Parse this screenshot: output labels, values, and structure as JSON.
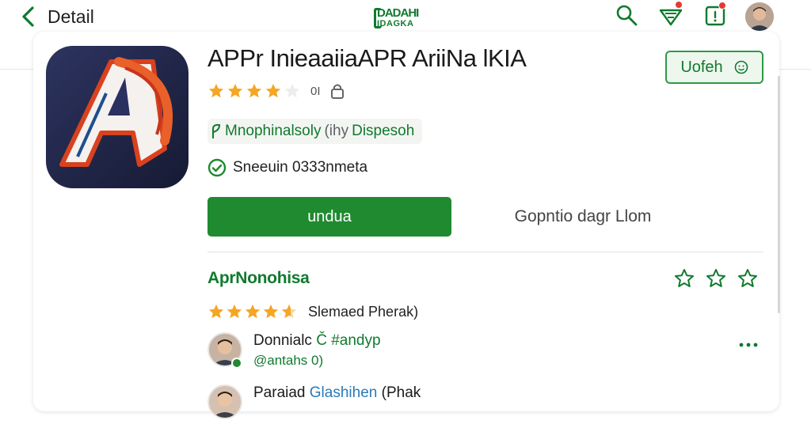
{
  "header": {
    "back_label": "Detail",
    "logo_line1": "DADAHI",
    "logo_line2": "IDAGKA"
  },
  "app": {
    "title": "APPr InieaaiiaAPR AriiNa lKIA",
    "rating_text": "0I",
    "rating_stars": 4,
    "tag_green": "Mnophinalsoly",
    "tag_gray": "(ihy",
    "tag_green2": "Dispesoh",
    "verified_text": "Sneeuin 0333nmeta",
    "install_label": "undua",
    "secondary_label": "Gopntio dagr Llom",
    "follow_label": "Uofeh"
  },
  "reviews_section": {
    "title": "AprNonohisa",
    "summary_text": "Slemaed Pherak)",
    "summary_stars": 4.5,
    "items": [
      {
        "name": "Donnialc",
        "name_extra_green": "Č #andyp",
        "sub": "@antahs 0)"
      },
      {
        "name": "Paraiad",
        "name_extra_blue": "Glashihen",
        "name_extra_gray": "(Phak"
      }
    ]
  },
  "colors": {
    "brand_green": "#1f8a2f",
    "text_green": "#107a2e",
    "star_gold": "#f5a623",
    "notification_red": "#e53935"
  },
  "icons": [
    "chevron-left-icon",
    "search-icon",
    "wifi-signal-icon",
    "notification-icon",
    "lock-icon",
    "check-circle-icon",
    "smile-icon",
    "star-outline-icon",
    "more-dots-icon"
  ]
}
